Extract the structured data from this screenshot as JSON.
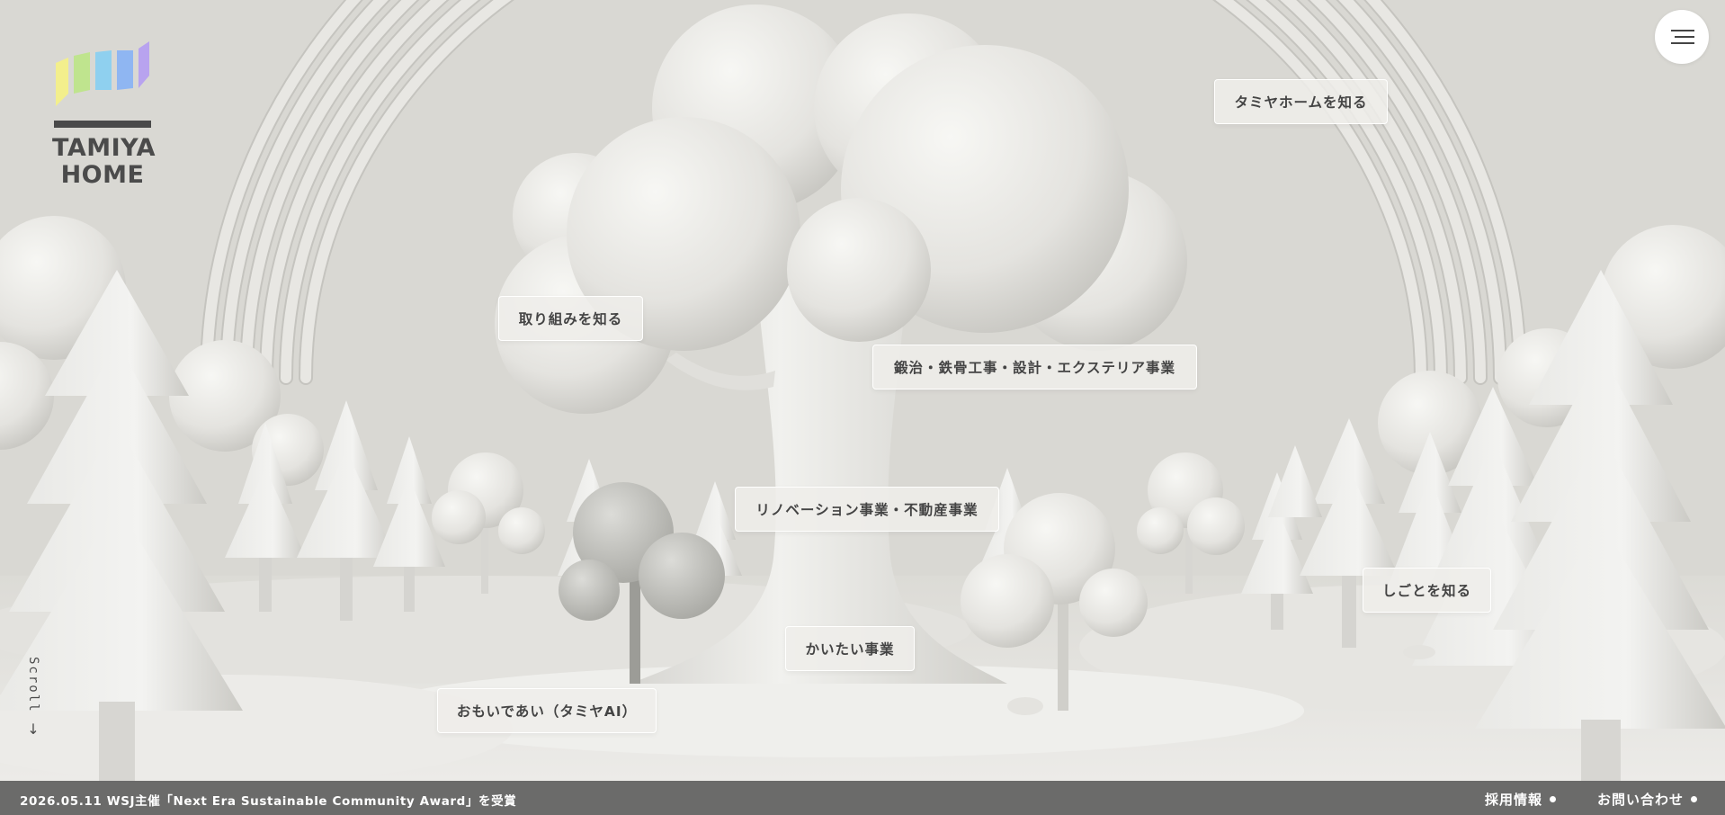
{
  "brand": {
    "name_line1": "TAMIYA",
    "name_line2": "HOME",
    "bar_colors": [
      "#f3ef8c",
      "#bfe48e",
      "#8fd0ef",
      "#8fb6f2",
      "#b8a3ef"
    ],
    "text_color": "#4a4a4a"
  },
  "menu": {
    "icon": "hamburger-icon"
  },
  "nav_tags": [
    {
      "label": "タミヤホームを知る"
    },
    {
      "label": "取り組みを知る"
    },
    {
      "label": "鍛治・鉄骨工事・設計・エクステリア事業"
    },
    {
      "label": "リノベーション事業・不動産事業"
    },
    {
      "label": "しごとを知る"
    },
    {
      "label": "かいたい事業"
    },
    {
      "label": "おもいであい（タミヤAI）"
    }
  ],
  "scroll": {
    "label": "Scroll",
    "arrow": "↓"
  },
  "footer": {
    "news": "2026.05.11 WSJ主催「Next Era Sustainable Community Award」を受賞",
    "links": [
      {
        "label": "採用情報"
      },
      {
        "label": "お問い合わせ"
      }
    ],
    "background": "#6b6b6a"
  },
  "colors": {
    "scene_background": "#d9d8d3",
    "sculpture": "#eeeeeb",
    "sculpture_shade": "#cfcfca"
  }
}
